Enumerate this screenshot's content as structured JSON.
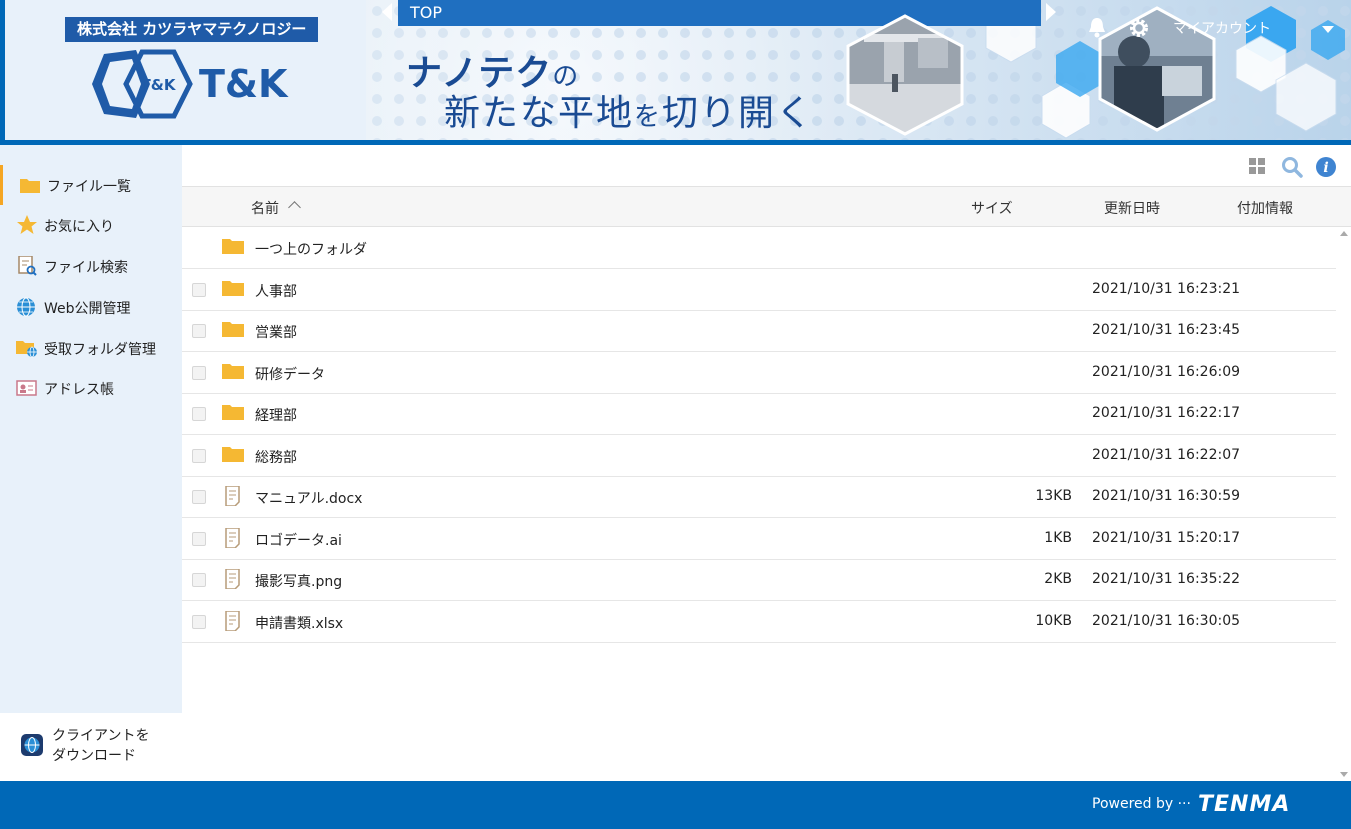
{
  "header": {
    "company_name": "株式会社 カツラヤマテクノロジー",
    "logo_text": "T&K",
    "logo_mark_text": "T&K",
    "breadcrumb": "TOP",
    "tagline_line1_main": "ナノテク",
    "tagline_line1_particle": "の",
    "tagline_line2_a": "新たな平地",
    "tagline_line2_particle": "を",
    "tagline_line2_b": "切り開く",
    "account_label": "マイアカウント",
    "brand_color": "#0068b7"
  },
  "sidebar": {
    "items": [
      {
        "label": "ファイル一覧",
        "icon": "folder-icon",
        "active": true
      },
      {
        "label": "お気に入り",
        "icon": "star-icon"
      },
      {
        "label": "ファイル検索",
        "icon": "file-search-icon"
      },
      {
        "label": "Web公開管理",
        "icon": "globe-icon"
      },
      {
        "label": "受取フォルダ管理",
        "icon": "folder-globe-icon"
      },
      {
        "label": "アドレス帳",
        "icon": "address-card-icon"
      }
    ],
    "download_line1": "クライアントを",
    "download_line2": "ダウンロード"
  },
  "table": {
    "headers": {
      "name": "名前",
      "size": "サイズ",
      "updated": "更新日時",
      "extra": "付加情報"
    },
    "parent_folder": "一つ上のフォルダ",
    "rows": [
      {
        "name": "人事部",
        "type": "folder",
        "size": "",
        "date": "2021/10/31 16:23:21"
      },
      {
        "name": "営業部",
        "type": "folder",
        "size": "",
        "date": "2021/10/31 16:23:45"
      },
      {
        "name": "研修データ",
        "type": "folder",
        "size": "",
        "date": "2021/10/31 16:26:09"
      },
      {
        "name": "経理部",
        "type": "folder",
        "size": "",
        "date": "2021/10/31 16:22:17"
      },
      {
        "name": "総務部",
        "type": "folder",
        "size": "",
        "date": "2021/10/31 16:22:07"
      },
      {
        "name": "マニュアル.docx",
        "type": "file",
        "size": "13KB",
        "date": "2021/10/31 16:30:59"
      },
      {
        "name": "ロゴデータ.ai",
        "type": "file",
        "size": "1KB",
        "date": "2021/10/31 15:20:17"
      },
      {
        "name": "撮影写真.png",
        "type": "file",
        "size": "2KB",
        "date": "2021/10/31 16:35:22"
      },
      {
        "name": "申請書類.xlsx",
        "type": "file",
        "size": "10KB",
        "date": "2021/10/31 16:30:05"
      }
    ]
  },
  "footer": {
    "powered_by": "Powered by ···",
    "brand": "TENMA"
  }
}
